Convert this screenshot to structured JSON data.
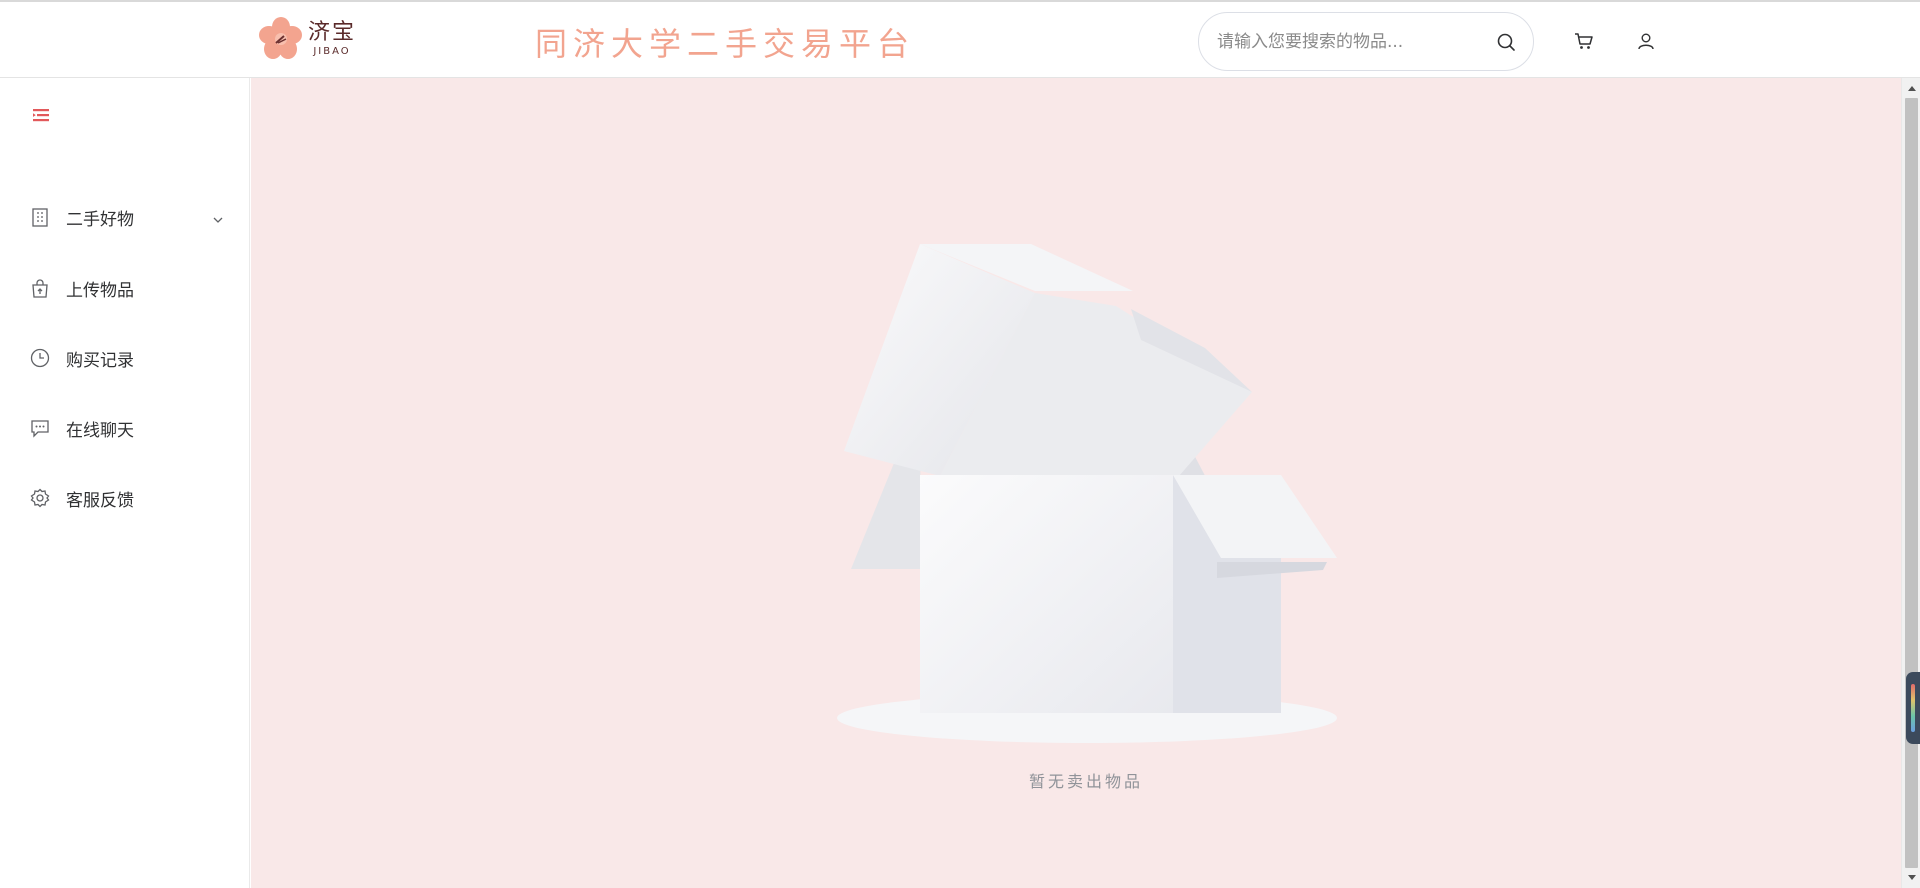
{
  "header": {
    "logo_cn": "济宝",
    "logo_en": "JIBAO",
    "site_title": "同济大学二手交易平台",
    "search": {
      "placeholder": "请输入您要搜索的物品..."
    },
    "icons": [
      "search-icon",
      "cart-icon",
      "user-icon"
    ]
  },
  "sidebar": {
    "items": [
      {
        "label": "二手好物",
        "icon": "building-icon",
        "has_submenu": true
      },
      {
        "label": "上传物品",
        "icon": "upload-bag-icon"
      },
      {
        "label": "购买记录",
        "icon": "clock-icon"
      },
      {
        "label": "在线聊天",
        "icon": "chat-icon"
      },
      {
        "label": "客服反馈",
        "icon": "gear-icon"
      }
    ]
  },
  "main": {
    "empty_text": "暂无卖出物品"
  },
  "colors": {
    "accent": "#e2595b",
    "title": "#f2a48f",
    "main_bg": "#f9e8e8"
  }
}
